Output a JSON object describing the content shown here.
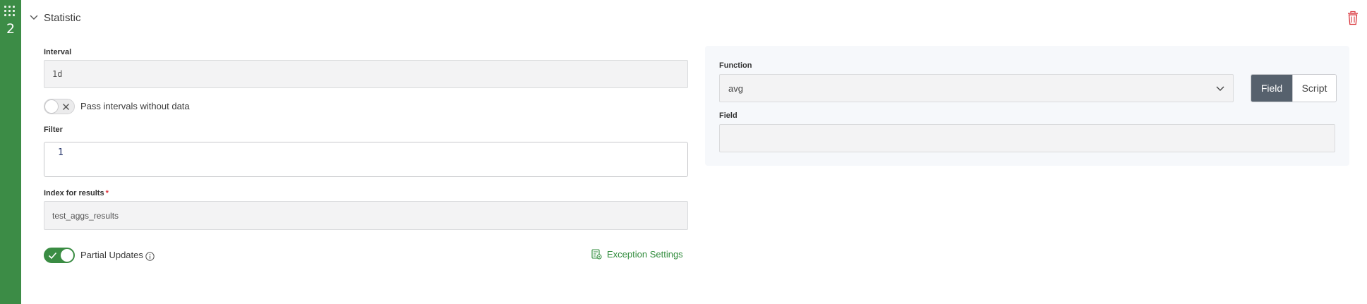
{
  "step": {
    "number": "2"
  },
  "section": {
    "title": "Statistic"
  },
  "left": {
    "interval": {
      "label": "Interval",
      "value": "1d"
    },
    "pass_intervals": {
      "label": "Pass intervals without data",
      "on": false
    },
    "filter": {
      "label": "Filter",
      "line_number": "1"
    },
    "index": {
      "label": "Index for results",
      "required_mark": "*",
      "value": "test_aggs_results"
    },
    "partial_updates": {
      "label": "Partial Updates",
      "on": true
    },
    "exception_settings": {
      "label": "Exception Settings"
    }
  },
  "right": {
    "function": {
      "label": "Function",
      "value": "avg"
    },
    "mode": {
      "options": [
        "Field",
        "Script"
      ],
      "selected": "Field"
    },
    "field": {
      "label": "Field",
      "value": ""
    }
  },
  "colors": {
    "accent": "#3c8c46",
    "link": "#2f8b3b",
    "danger": "#d9343b",
    "segment_active": "#56616d"
  },
  "icons": {
    "drag": "drag-grid-icon",
    "collapse": "chevron-down-icon",
    "delete": "trash-icon",
    "info": "info-icon",
    "settings": "settings-list-icon"
  }
}
